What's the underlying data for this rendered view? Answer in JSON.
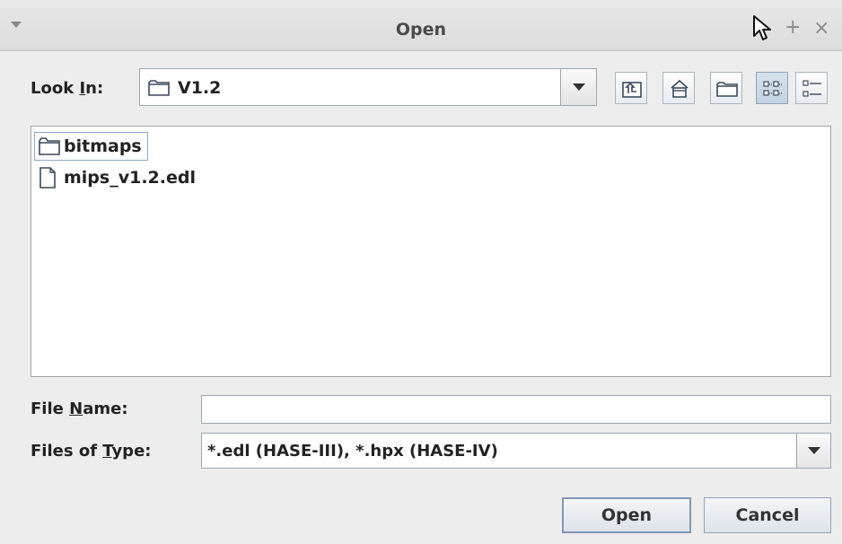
{
  "dialog": {
    "title": "Open"
  },
  "look_in": {
    "label_pre": "Look ",
    "label_mnemonic": "I",
    "label_post": "n:",
    "value": "V1.2"
  },
  "toolbar": {
    "buttons": [
      {
        "name": "up-one-level",
        "icon": "folder-up-icon"
      },
      {
        "name": "home",
        "icon": "home-icon"
      },
      {
        "name": "new-folder",
        "icon": "new-folder-icon"
      },
      {
        "name": "list-view",
        "icon": "list-view-icon",
        "active": true
      },
      {
        "name": "details-view",
        "icon": "details-view-icon"
      }
    ]
  },
  "files": [
    {
      "name": "bitmaps",
      "type": "folder",
      "focused": true
    },
    {
      "name": "mips_v1.2.edl",
      "type": "file",
      "focused": false
    }
  ],
  "file_name": {
    "label_pre": "File ",
    "label_mnemonic": "N",
    "label_post": "ame:",
    "value": ""
  },
  "file_type": {
    "label_pre": "Files of ",
    "label_mnemonic": "T",
    "label_post": "ype:",
    "value": "*.edl (HASE-III), *.hpx (HASE-IV)"
  },
  "buttons": {
    "open": "Open",
    "cancel": "Cancel"
  },
  "titlebar_glyphs": {
    "plus": "+",
    "close": "×"
  }
}
